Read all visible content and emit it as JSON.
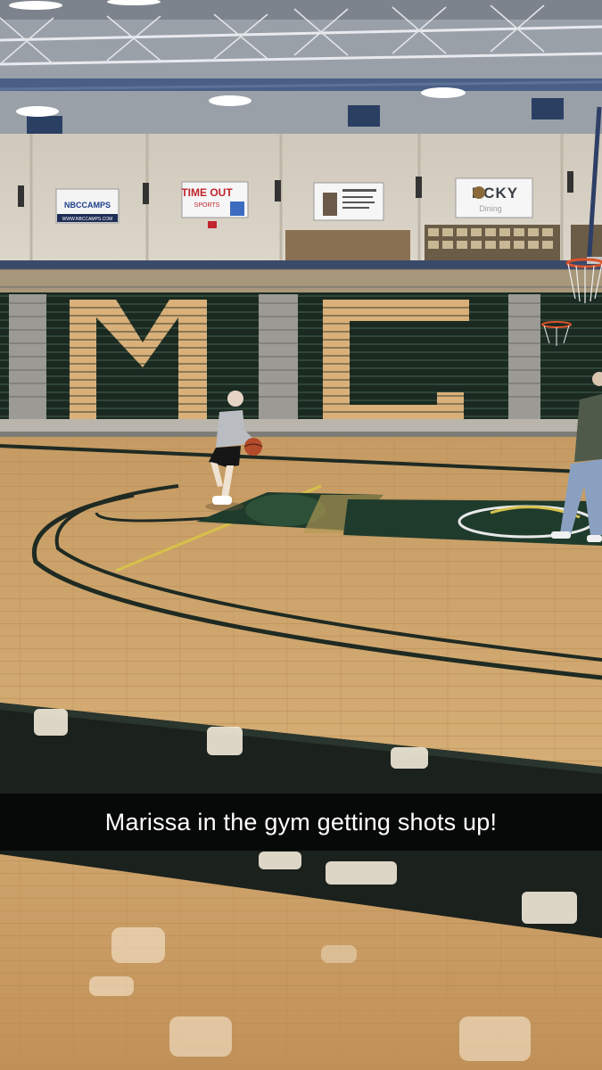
{
  "caption": {
    "text": "Marissa in the gym getting shots up!"
  },
  "signs": {
    "nbc": {
      "line1": "NBCCAMPS",
      "line2": "WWW.NBCCAMPS.COM"
    },
    "timeout": {
      "line1": "TIME OUT",
      "line2": "SPORTS"
    },
    "rocky": {
      "line1": "RCKY",
      "line2": "Dining"
    }
  },
  "bleacher_letters": [
    "M",
    "C"
  ],
  "colors": {
    "court_green": "#1f3b2c",
    "seat_green": "#1c2a22",
    "letter_gold": "#d9b07a",
    "floor_wood": "#c9a46c",
    "wall": "#d8d2c6"
  }
}
